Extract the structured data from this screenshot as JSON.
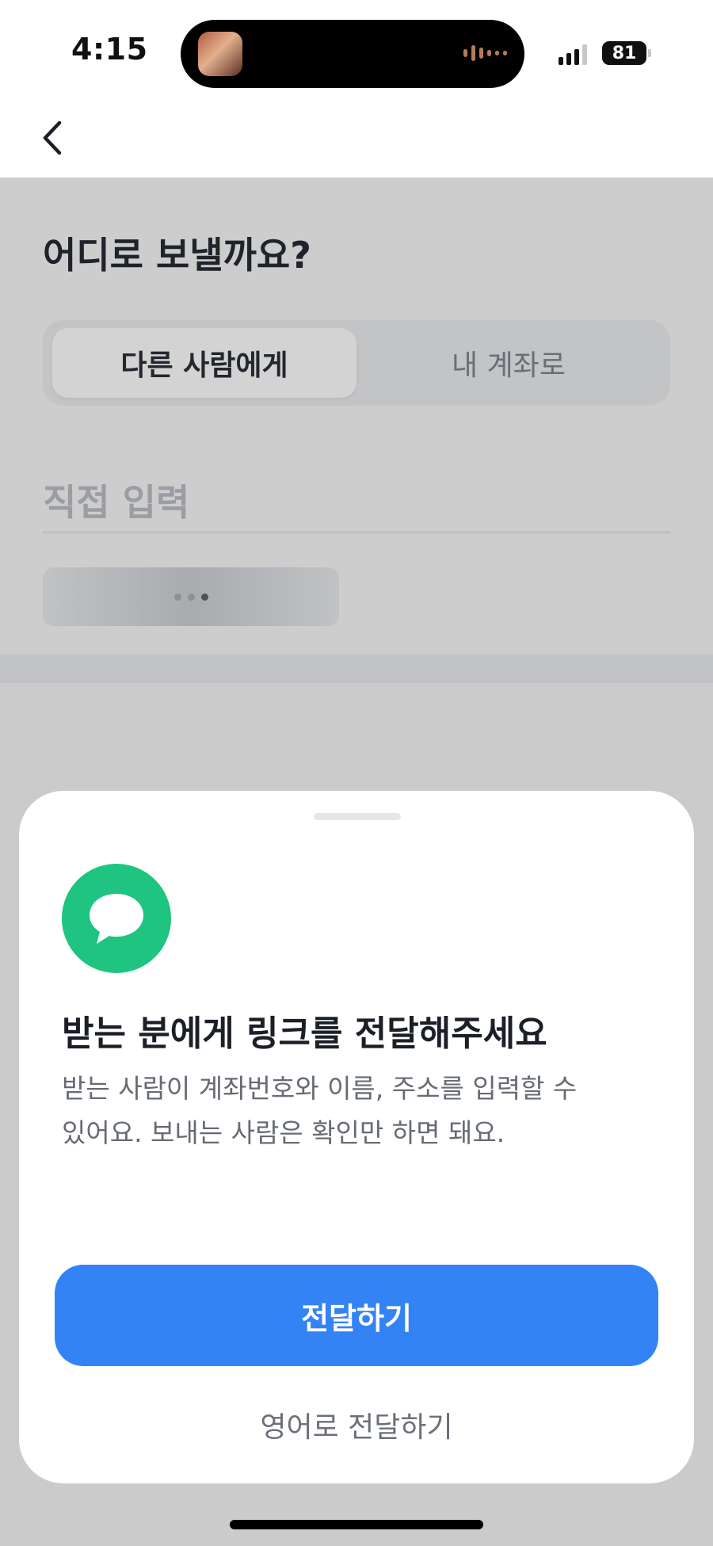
{
  "status_bar": {
    "time": "4:15",
    "battery": "81",
    "icons": [
      "signal-icon",
      "battery-icon"
    ]
  },
  "nav": {
    "back_icon": "chevron-left-icon"
  },
  "main": {
    "title": "어디로 보낼까요?",
    "segment": {
      "options": [
        "다른 사람에게",
        "내 계좌로"
      ],
      "selected": "다른 사람에게"
    },
    "input_placeholder": "직접 입력"
  },
  "sheet": {
    "icon": "chat-bubble-icon",
    "title": "받는 분에게 링크를 전달해주세요",
    "description": "받는 사람이 계좌번호와 이름, 주소를 입력할 수\n있어요. 보내는 사람은 확인만 하면 돼요.",
    "primary_button": "전달하기",
    "secondary_button": "영어로 전달하기"
  },
  "colors": {
    "accent": "#3483f5",
    "icon_green": "#1ec47f",
    "dim_background": "#cbcbcc"
  }
}
